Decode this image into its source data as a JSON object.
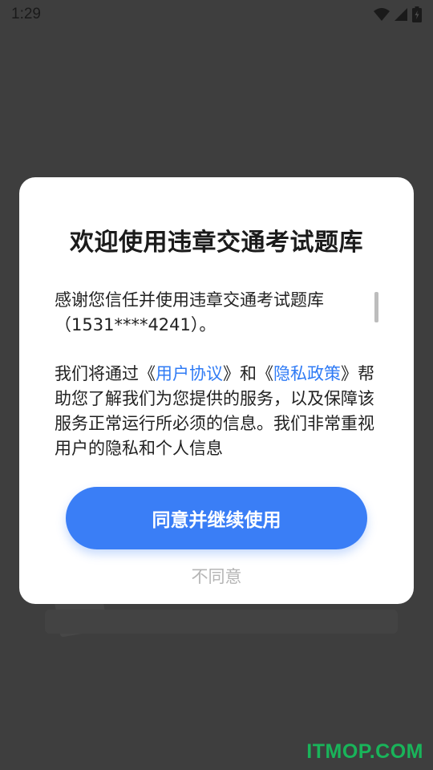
{
  "status_bar": {
    "time": "1:29"
  },
  "dialog": {
    "title": "欢迎使用违章交通考试题库",
    "paragraph1": {
      "line1": "感谢您信任并使用违章交通考试题库",
      "line2": "（1531****4241）。"
    },
    "paragraph2": {
      "text_before": "我们将通过《",
      "user_agreement_link": "用户协议",
      "text_middle": "》和《",
      "privacy_policy_link": "隐私政策",
      "text_after": "》帮助您了解我们为您提供的服务，以及保障该服务正常运行所必须的信息。我们非常重视用户的隐私和个人信息"
    },
    "agree_button_label": "同意并继续使用",
    "disagree_label": "不同意"
  },
  "watermark": "ITMOP.COM",
  "colors": {
    "accent": "#3a7ef6",
    "link": "#2f7bf5",
    "watermark": "#19b45a"
  }
}
